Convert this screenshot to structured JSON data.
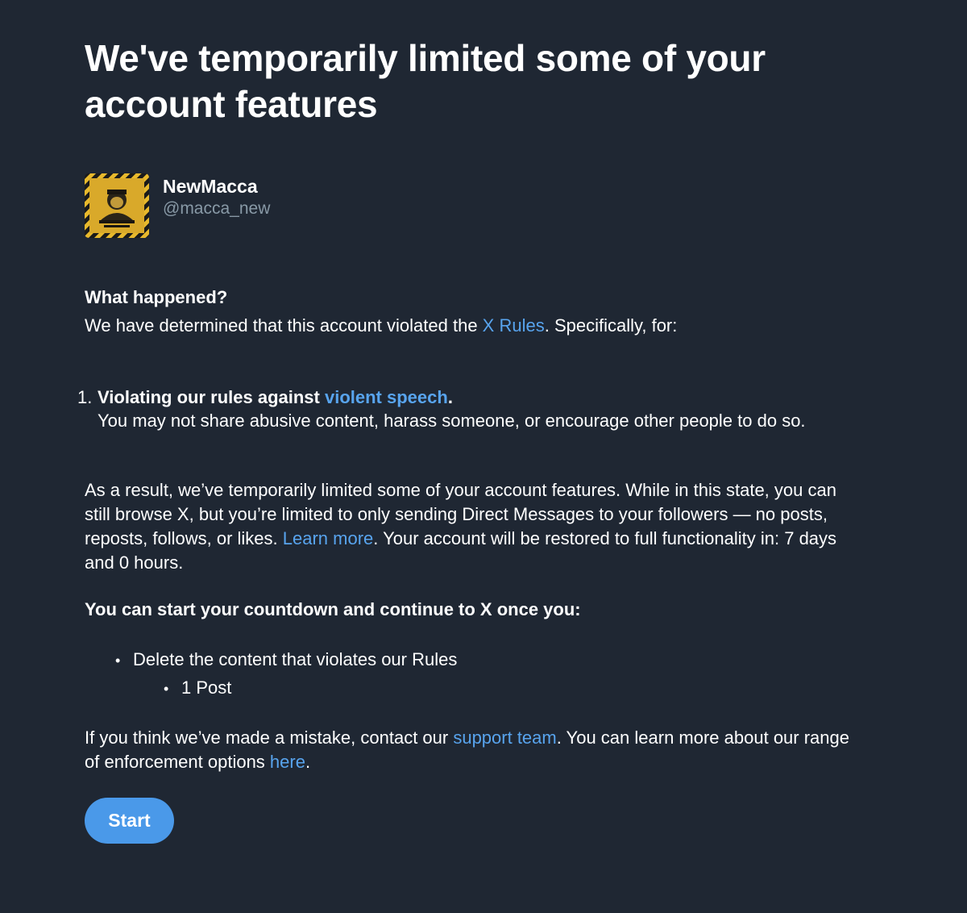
{
  "title": "We've temporarily limited some of your account features",
  "account": {
    "display_name": "NewMacca",
    "handle": "@macca_new",
    "avatar_icon": "warning-tape-photo-avatar"
  },
  "what_happened": {
    "heading": "What happened?",
    "line_prefix": "We have determined that this account violated the ",
    "line_link": "X Rules",
    "line_suffix": ". Specifically, for:"
  },
  "violation": {
    "number": "1.",
    "title_prefix": "Violating our rules against ",
    "title_link": "violent speech",
    "title_suffix": ".",
    "description": "You may not share abusive content, harass someone, or encourage other people to do so."
  },
  "result": {
    "text_before": "As a result, we’ve temporarily limited some of your account features. While in this state, you can still browse X, but you’re limited to only sending Direct Messages to your followers — no posts, reposts, follows, or likes. ",
    "link": "Learn more",
    "text_after": ". Your account will be restored to full functionality in: 7 days and 0 hours."
  },
  "countdown": {
    "heading": "You can start your countdown and continue to X once you:",
    "items": [
      {
        "label": "Delete the content that violates our Rules",
        "sub_items": [
          "1 Post"
        ]
      }
    ]
  },
  "mistake": {
    "text1": "If you think we’ve made a mistake, contact our ",
    "link1": "support team",
    "text2": ". You can learn more about our range of enforcement options ",
    "link2": "here",
    "text3": "."
  },
  "start_button": "Start",
  "colors": {
    "background": "#1f2733",
    "link": "#58a4ee",
    "button": "#4a99e9",
    "handle": "#8899a6"
  }
}
